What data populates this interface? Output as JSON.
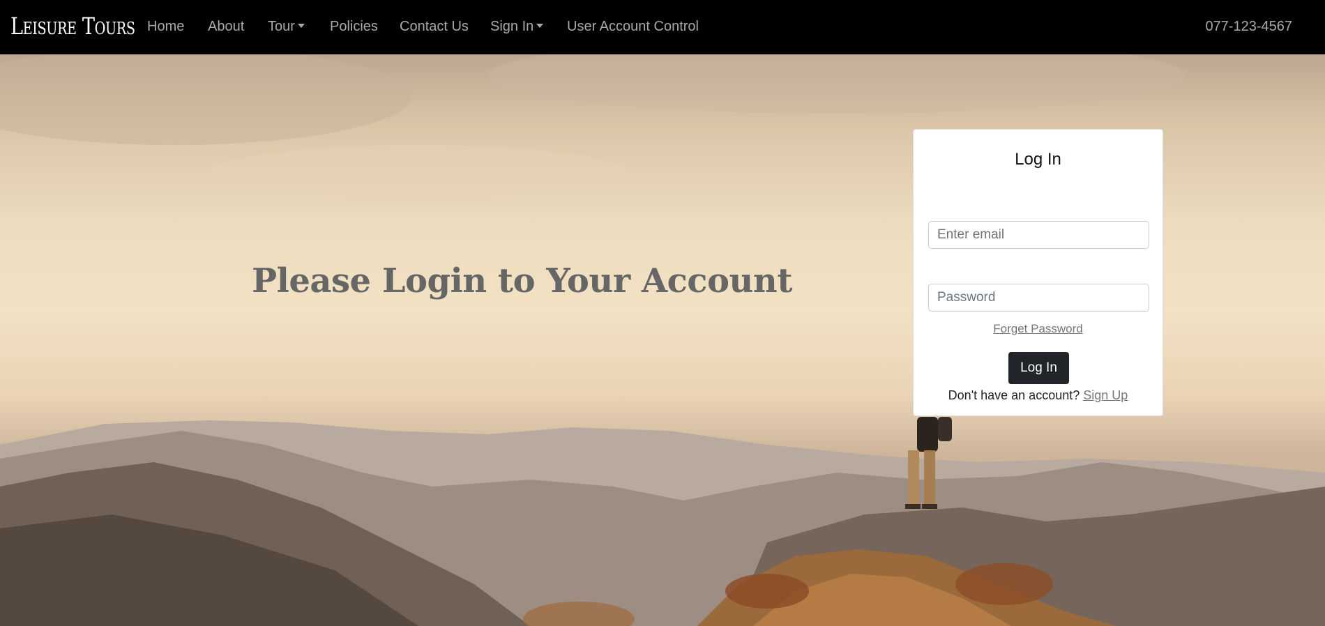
{
  "navbar": {
    "brand": "Leisure Tours",
    "links": {
      "home": "Home",
      "about": "About",
      "tour": "Tour",
      "policies": "Policies",
      "contact": "Contact Us",
      "signin": "Sign In",
      "uac": "User Account Control"
    },
    "phone": "077-123-4567"
  },
  "hero": {
    "headline": "Please Login to Your Account"
  },
  "login": {
    "title": "Log In",
    "email_placeholder": "Enter email",
    "password_placeholder": "Password",
    "forgot": "Forget Password",
    "button": "Log In",
    "signup_prompt": "Don't have an account?",
    "signup_link": "Sign Up"
  },
  "colors": {
    "navbar_bg": "#000000",
    "nav_text": "#a9a9a9",
    "button_bg": "#212529",
    "headline": "#666666"
  },
  "icons": {
    "dropdown": "chevron-down-icon"
  }
}
